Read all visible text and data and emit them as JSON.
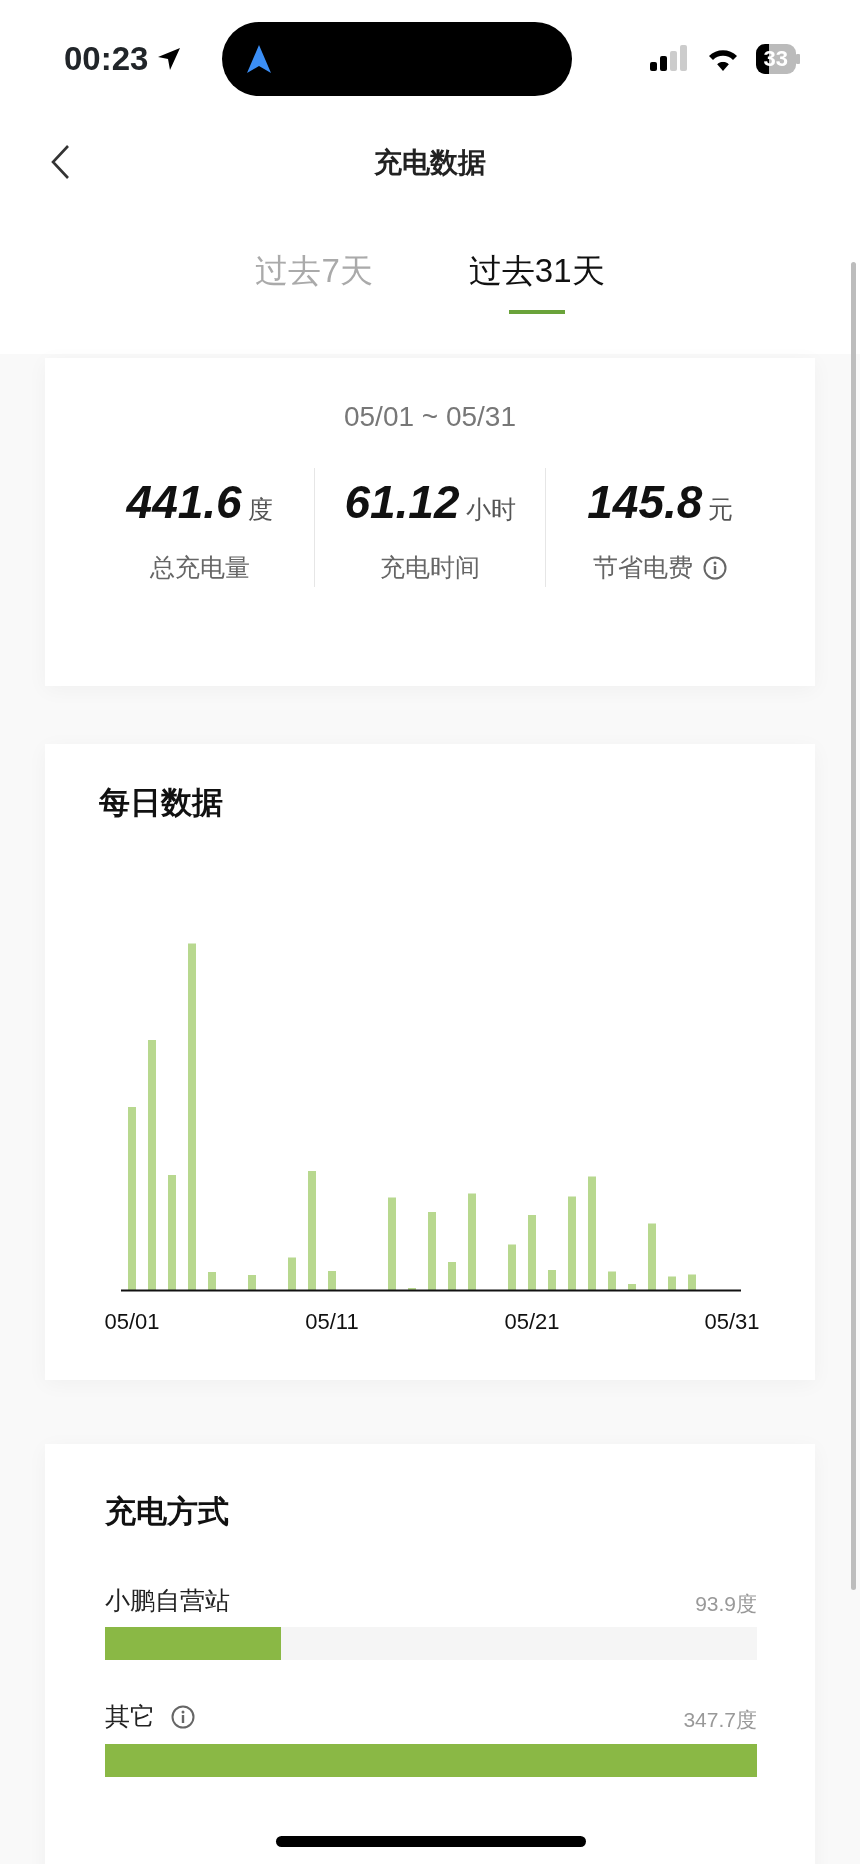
{
  "status_bar": {
    "time": "00:23",
    "battery": "33"
  },
  "header": {
    "title": "充电数据"
  },
  "tabs": [
    {
      "label": "过去7天",
      "selected": false
    },
    {
      "label": "过去31天",
      "selected": true
    }
  ],
  "summary": {
    "date_range": "05/01 ~ 05/31",
    "stats": [
      {
        "value": "441.6",
        "unit": "度",
        "label": "总充电量",
        "info": false
      },
      {
        "value": "61.12",
        "unit": "小时",
        "label": "充电时间",
        "info": false
      },
      {
        "value": "145.8",
        "unit": "元",
        "label": "节省电费",
        "info": true
      }
    ]
  },
  "daily": {
    "title": "每日数据",
    "x_labels": [
      "05/01",
      "05/11",
      "05/21",
      "05/31"
    ]
  },
  "methods": {
    "title": "充电方式",
    "items": [
      {
        "name": "小鹏自营站",
        "reading": "93.9度",
        "level": 0.27,
        "info": false
      },
      {
        "name": "其它",
        "reading": "347.7度",
        "level": 1.0,
        "info": true
      }
    ]
  }
}
